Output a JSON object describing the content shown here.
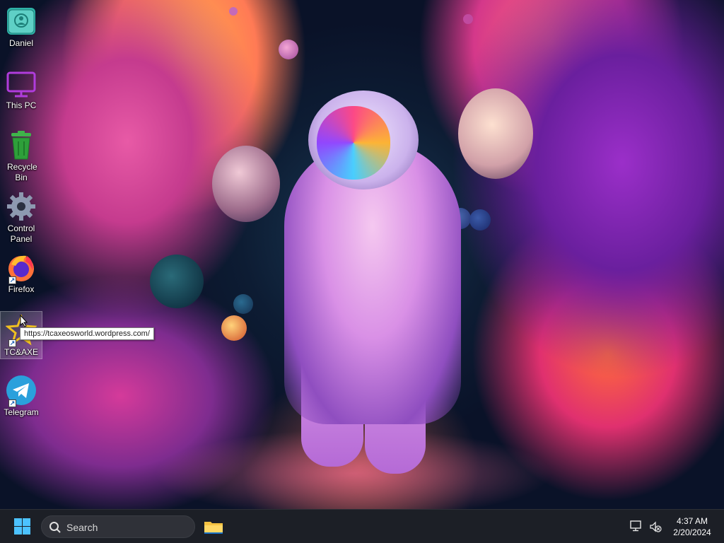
{
  "desktop": {
    "icons": [
      {
        "label": "Daniel"
      },
      {
        "label": "This PC"
      },
      {
        "label": "Recycle Bin"
      },
      {
        "label": "Control Panel"
      },
      {
        "label": "Firefox"
      },
      {
        "label": "TC&AXE"
      },
      {
        "label": "Telegram"
      }
    ],
    "tooltip": "https://tcaxeosworld.wordpress.com/"
  },
  "taskbar": {
    "search_label": "Search",
    "clock_time": "4:37 AM",
    "clock_date": "2/20/2024",
    "icons": [
      "windows-start-icon",
      "search-icon",
      "file-explorer-icon",
      "network-icon",
      "volume-muted-icon"
    ]
  },
  "colors": {
    "taskbar_bg": "#1c1f26",
    "start_blue": "#4cc2ff",
    "folder_yellow": "#f5c242"
  }
}
